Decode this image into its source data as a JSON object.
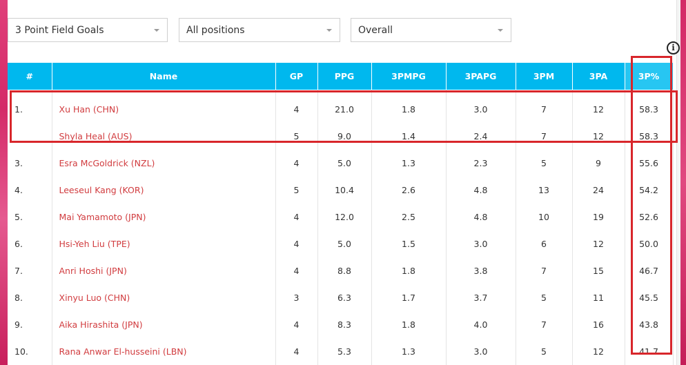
{
  "filters": {
    "stat": "3 Point Field Goals",
    "position": "All positions",
    "scope": "Overall"
  },
  "info_icon": "i",
  "columns": [
    "#",
    "Name",
    "GP",
    "PPG",
    "3PMPG",
    "3PAPG",
    "3PM",
    "3PA",
    "3P%"
  ],
  "rows": [
    {
      "rank": "1.",
      "name": "Xu Han (CHN)",
      "gp": "4",
      "ppg": "21.0",
      "tpmpg": "1.8",
      "tpapg": "3.0",
      "tpm": "7",
      "tpa": "12",
      "tppct": "58.3"
    },
    {
      "rank": "",
      "name": "Shyla Heal (AUS)",
      "gp": "5",
      "ppg": "9.0",
      "tpmpg": "1.4",
      "tpapg": "2.4",
      "tpm": "7",
      "tpa": "12",
      "tppct": "58.3"
    },
    {
      "rank": "3.",
      "name": "Esra McGoldrick (NZL)",
      "gp": "4",
      "ppg": "5.0",
      "tpmpg": "1.3",
      "tpapg": "2.3",
      "tpm": "5",
      "tpa": "9",
      "tppct": "55.6"
    },
    {
      "rank": "4.",
      "name": "Leeseul Kang (KOR)",
      "gp": "5",
      "ppg": "10.4",
      "tpmpg": "2.6",
      "tpapg": "4.8",
      "tpm": "13",
      "tpa": "24",
      "tppct": "54.2"
    },
    {
      "rank": "5.",
      "name": "Mai Yamamoto (JPN)",
      "gp": "4",
      "ppg": "12.0",
      "tpmpg": "2.5",
      "tpapg": "4.8",
      "tpm": "10",
      "tpa": "19",
      "tppct": "52.6"
    },
    {
      "rank": "6.",
      "name": "Hsi-Yeh Liu (TPE)",
      "gp": "4",
      "ppg": "5.0",
      "tpmpg": "1.5",
      "tpapg": "3.0",
      "tpm": "6",
      "tpa": "12",
      "tppct": "50.0"
    },
    {
      "rank": "7.",
      "name": "Anri Hoshi (JPN)",
      "gp": "4",
      "ppg": "8.8",
      "tpmpg": "1.8",
      "tpapg": "3.8",
      "tpm": "7",
      "tpa": "15",
      "tppct": "46.7"
    },
    {
      "rank": "8.",
      "name": "Xinyu Luo (CHN)",
      "gp": "3",
      "ppg": "6.3",
      "tpmpg": "1.7",
      "tpapg": "3.7",
      "tpm": "5",
      "tpa": "11",
      "tppct": "45.5"
    },
    {
      "rank": "9.",
      "name": "Aika Hirashita (JPN)",
      "gp": "4",
      "ppg": "8.3",
      "tpmpg": "1.8",
      "tpapg": "4.0",
      "tpm": "7",
      "tpa": "16",
      "tppct": "43.8"
    },
    {
      "rank": "10.",
      "name": "Rana Anwar El-husseini (LBN)",
      "gp": "4",
      "ppg": "5.3",
      "tpmpg": "1.3",
      "tpapg": "3.0",
      "tpm": "5",
      "tpa": "12",
      "tppct": "41.7"
    }
  ],
  "colors": {
    "header_bg": "#00b8ee",
    "player_link": "#d13c3f",
    "highlight": "#d8262b",
    "edge_pink": "#d42a68"
  }
}
